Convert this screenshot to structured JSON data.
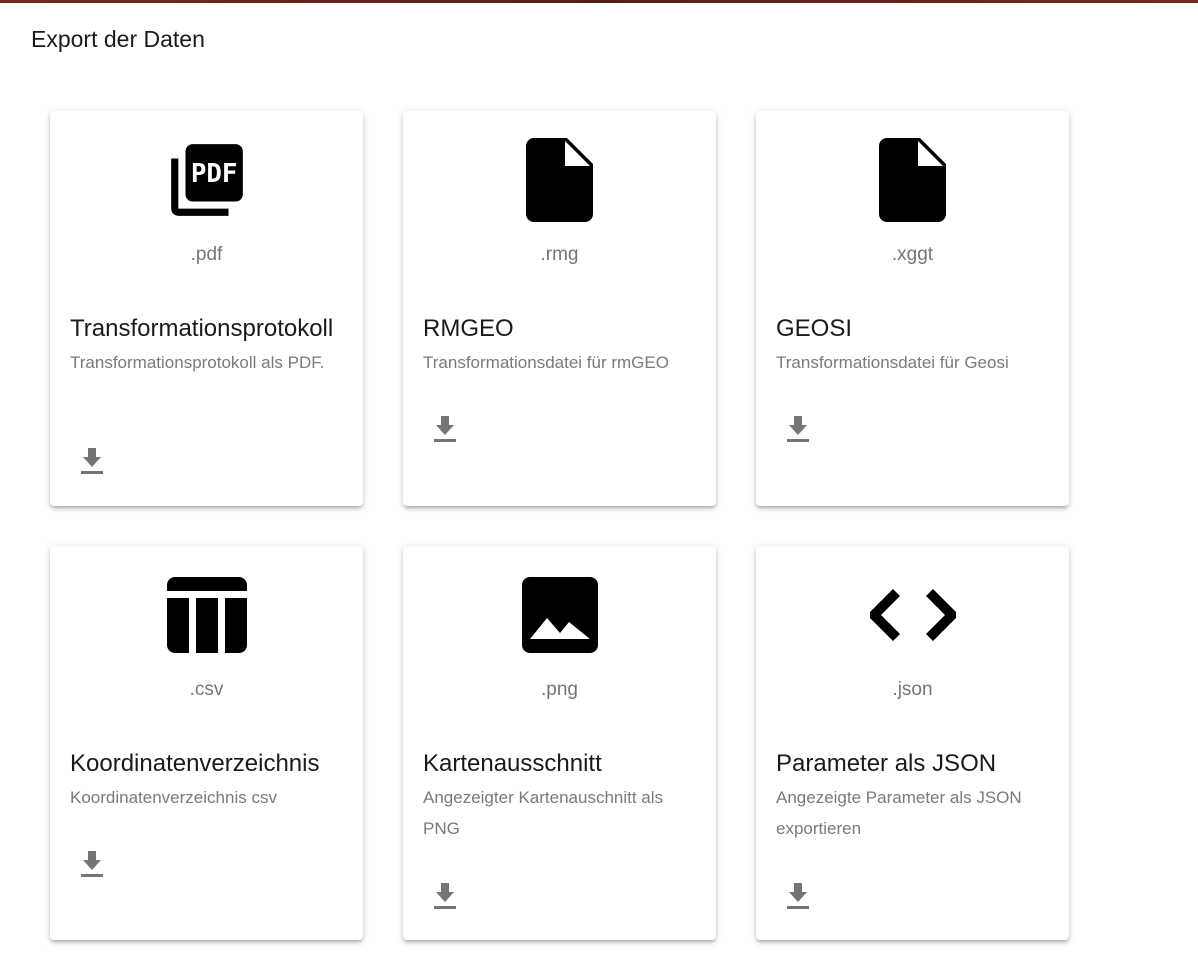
{
  "dialog": {
    "title": "Export der Daten"
  },
  "cards": [
    {
      "icon": "picture-as-pdf-icon",
      "extension": ".pdf",
      "title": "Transformationsprotokoll",
      "description": "Transformationsprotokoll als PDF.",
      "download_icon": "download-icon"
    },
    {
      "icon": "file-icon",
      "extension": ".rmg",
      "title": "RMGEO",
      "description": "Transformationsdatei für rmGEO",
      "download_icon": "download-icon"
    },
    {
      "icon": "file-icon",
      "extension": ".xggt",
      "title": "GEOSI",
      "description": "Transformationsdatei für Geosi",
      "download_icon": "download-icon"
    },
    {
      "icon": "table-icon",
      "extension": ".csv",
      "title": "Koordinatenverzeichnis",
      "description": "Koordinatenverzeichnis csv",
      "download_icon": "download-icon"
    },
    {
      "icon": "image-icon",
      "extension": ".png",
      "title": "Kartenausschnitt",
      "description": "Angezeigter Kartenauschnitt als PNG",
      "download_icon": "download-icon"
    },
    {
      "icon": "code-icon",
      "extension": ".json",
      "title": "Parameter als JSON",
      "description": "Angezeigte Parameter als JSON exportieren",
      "download_icon": "download-icon"
    }
  ],
  "colors": {
    "icon": "#000000",
    "extension_text": "#757575",
    "description_text": "#7a7a7a",
    "download_icon": "#757575",
    "top_accent": "#6b2418"
  }
}
